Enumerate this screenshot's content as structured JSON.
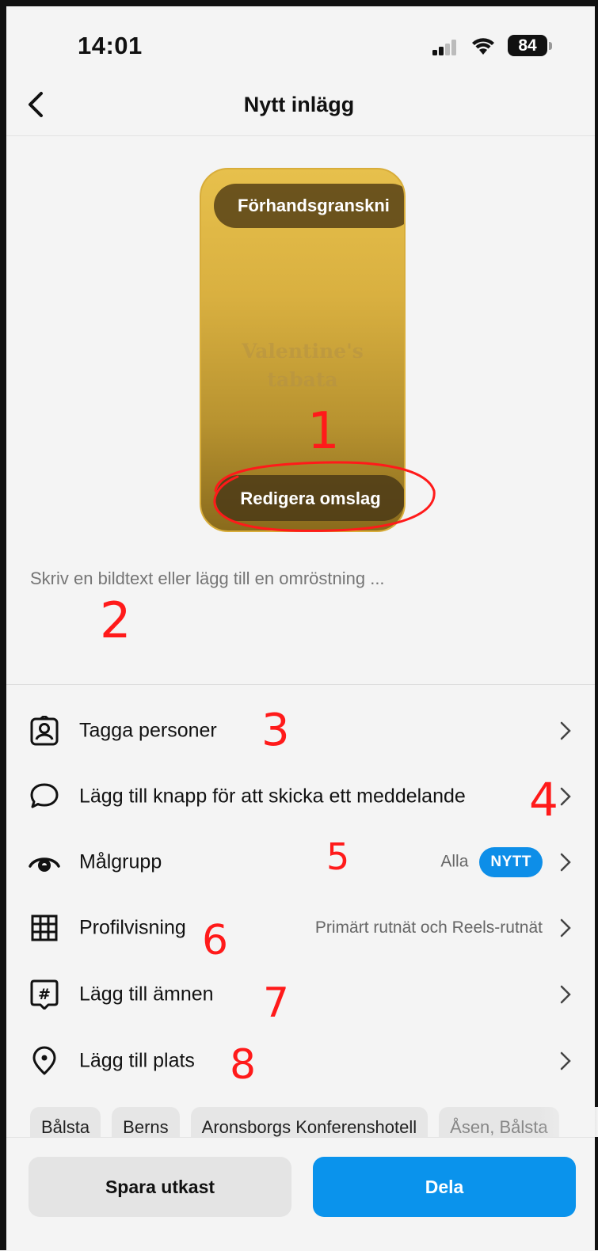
{
  "status_bar": {
    "time": "14:01",
    "battery": "84"
  },
  "header": {
    "title": "Nytt inlägg"
  },
  "preview": {
    "preview_label": "Förhandsgranskni",
    "cover_text": "Valentine's\ntabata",
    "edit_cover_label": "Redigera omslag"
  },
  "caption": {
    "placeholder": "Skriv en bildtext eller lägg till en omröstning ..."
  },
  "rows": [
    {
      "label": "Tagga personer",
      "icon": "person-tag-icon"
    },
    {
      "label": "Lägg till knapp för att skicka ett meddelande",
      "icon": "chat-bubble-icon"
    },
    {
      "label": "Målgrupp",
      "value": "Alla",
      "badge": "NYTT",
      "icon": "eye-icon"
    },
    {
      "label": "Profilvisning",
      "value": "Primärt rutnät och Reels-rutnät",
      "icon": "grid-icon"
    },
    {
      "label": "Lägg till ämnen",
      "icon": "hashtag-icon"
    },
    {
      "label": "Lägg till plats",
      "icon": "location-pin-icon"
    }
  ],
  "location_chips": [
    "Bålsta",
    "Berns",
    "Aronsborgs Konferenshotell",
    "Åsen, Bålsta"
  ],
  "actions": {
    "save_draft": "Spara utkast",
    "share": "Dela"
  },
  "annotations": [
    "1",
    "2",
    "3",
    "4",
    "5",
    "6",
    "7",
    "8"
  ],
  "colors": {
    "accent": "#0a93ec",
    "annotation": "#ff1a1a",
    "cover_gold": "#d9b040"
  }
}
